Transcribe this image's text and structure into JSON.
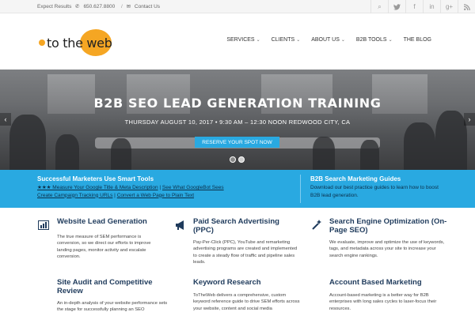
{
  "topbar": {
    "expect_label": "Expect Results",
    "phone_icon": "phone-icon",
    "phone": "650.627.8800",
    "sep": "/",
    "email_icon": "mail-icon",
    "contact_label": "Contact Us",
    "social": [
      {
        "icon": "search-icon",
        "glyph": "⌕"
      },
      {
        "icon": "twitter-icon",
        "glyph": "🐦"
      },
      {
        "icon": "facebook-icon",
        "glyph": "f"
      },
      {
        "icon": "linkedin-icon",
        "glyph": "in"
      },
      {
        "icon": "googleplus-icon",
        "glyph": "g+"
      },
      {
        "icon": "rss-icon",
        "glyph": "◉"
      }
    ]
  },
  "logo": {
    "text": "to the web"
  },
  "nav": [
    {
      "label": "SERVICES",
      "has_dropdown": true
    },
    {
      "label": "CLIENTS",
      "has_dropdown": true
    },
    {
      "label": "ABOUT US",
      "has_dropdown": true
    },
    {
      "label": "B2B TOOLS",
      "has_dropdown": true
    },
    {
      "label": "THE BLOG",
      "has_dropdown": false
    }
  ],
  "hero": {
    "title": "B2B SEO LEAD GENERATION TRAINING",
    "subtitle": "THURSDAY AUGUST 10, 2017 • 9:30 AM – 12:30 NOON REDWOOD CITY, CA",
    "button": "RESERVE YOUR SPOT NOW",
    "prev_arrow": "‹",
    "next_arrow": "›"
  },
  "band": {
    "left_title": "Successful Marketers Use Smart Tools",
    "left_line1_a": "★★★ Measure Your Google Title & Meta Description",
    "left_line1_sep": " | ",
    "left_line1_b": "See What GoogleBot Sees",
    "left_line2_a": "Create Campaign Tracking URLs",
    "left_line2_sep": " | ",
    "left_line2_b": "Convert a Web Page to Plain Text",
    "right_title": "B2B Search Marketing Guides",
    "right_desc": "Download our best practice guides to learn how to boost B2B lead generation."
  },
  "services": [
    {
      "icon": "bar-chart-icon",
      "glyph": "📊",
      "title": "Website Lead Generation",
      "desc": "The true measure of SEM performance is conversion, so we direct our efforts to improve landing pages, monitor activity and escalate conversion."
    },
    {
      "icon": "megaphone-icon",
      "glyph": "📢",
      "title": "Paid Search Advertising (PPC)",
      "desc": "Pay-Per-Click (PPC), YouTube and remarketing advertising programs are created and implemented to create a steady flow of traffic and pipeline sales leads."
    },
    {
      "icon": "magic-wand-icon",
      "glyph": "✨",
      "title": "Search Engine Optimization (On-Page SEO)",
      "desc": "We evaluate, improve and optimize the use of keywords, tags, and metadata across your site to increase your search engine rankings."
    },
    {
      "icon": "",
      "glyph": "",
      "title": "Site Audit and Competitive Review",
      "desc": "An in-depth analysis of your website performance sets the stage for successfully planning an SEO"
    },
    {
      "icon": "",
      "glyph": "",
      "title": "Keyword Research",
      "desc": "ToTheWeb delivers a comprehensive, custom keyword reference guide to drive SEM efforts across your website, content and social media"
    },
    {
      "icon": "",
      "glyph": "",
      "title": "Account Based Marketing",
      "desc": "Account-based marketing is a better way for B2B enterprises with long sales cycles to laser-focus their resources."
    }
  ]
}
